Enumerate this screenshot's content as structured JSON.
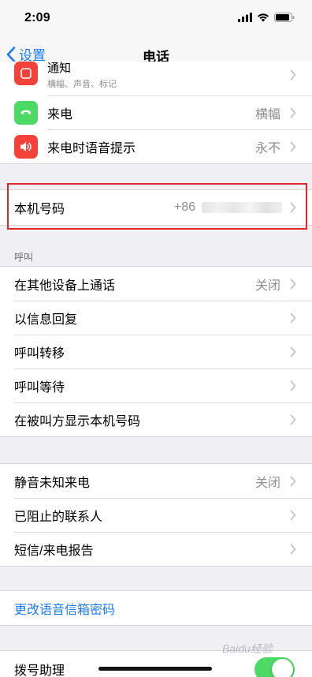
{
  "status_bar": {
    "time": "2:09"
  },
  "nav": {
    "back_label": "设置",
    "title": "电话"
  },
  "top_group": {
    "partial_row": {
      "label": "通知",
      "sublabel": "横幅、声音、标记"
    },
    "rows": [
      {
        "label": "来电",
        "value": "横幅",
        "icon": "phone-icon"
      },
      {
        "label": "来电时语音提示",
        "value": "永不",
        "icon": "speaker-icon"
      }
    ]
  },
  "my_number": {
    "label": "本机号码",
    "prefix": "+86"
  },
  "calls_section": {
    "header": "呼叫",
    "rows": [
      {
        "label": "在其他设备上通话",
        "value": "关闭"
      },
      {
        "label": "以信息回复",
        "value": ""
      },
      {
        "label": "呼叫转移",
        "value": ""
      },
      {
        "label": "呼叫等待",
        "value": ""
      },
      {
        "label": "在被叫方显示本机号码",
        "value": ""
      }
    ]
  },
  "blocking_section": {
    "rows": [
      {
        "label": "静音未知来电",
        "value": "关闭"
      },
      {
        "label": "已阻止的联系人",
        "value": ""
      },
      {
        "label": "短信/来电报告",
        "value": ""
      }
    ]
  },
  "voicemail": {
    "label": "更改语音信箱密码"
  },
  "dial_assist": {
    "label": "拨号助理",
    "enabled": true
  },
  "watermark": "Baidu经验",
  "colors": {
    "accent": "#1b7cf5",
    "toggle_on": "#4cd964",
    "highlight": "#e0262a"
  }
}
